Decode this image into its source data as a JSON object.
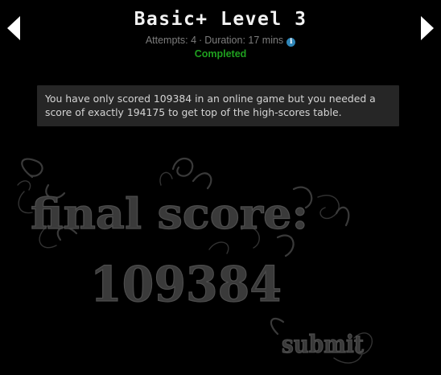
{
  "header": {
    "title": "Basic+ Level 3",
    "attempts": "Attempts: 4",
    "separator": "·",
    "duration": "Duration: 17 mins",
    "info_icon": "info-icon",
    "status": "Completed",
    "prev_icon": "chevron-left-icon",
    "next_icon": "chevron-right-icon"
  },
  "message": {
    "text": "You have only scored 109384 in an online game but you needed a score of exactly 194175 to get top of the high-scores table."
  },
  "result": {
    "heading": "final score:",
    "score": "109384",
    "submit_label": "submit"
  },
  "colors": {
    "background": "#000000",
    "title": "#f2f2f2",
    "meta": "#7d7d7d",
    "status": "#1fa01f",
    "info": "#2f86b8",
    "message_bg": "#262626",
    "art": "#3a3a3a"
  }
}
